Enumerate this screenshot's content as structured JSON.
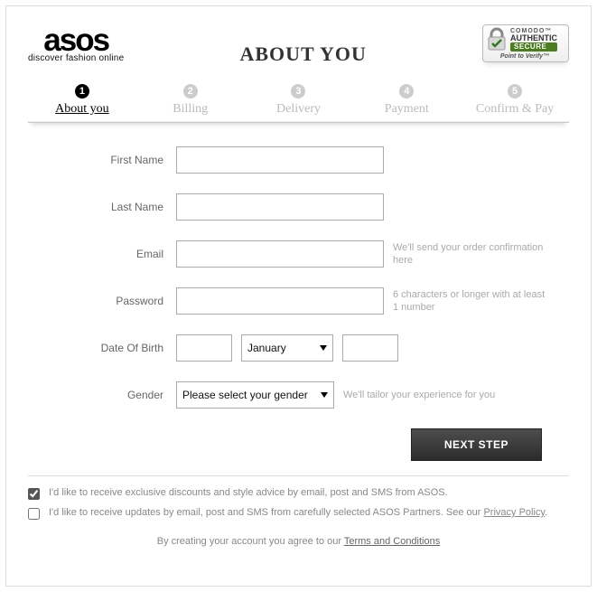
{
  "brand": {
    "name": "asos",
    "tagline": "discover fashion online"
  },
  "title": "ABOUT YOU",
  "secure": {
    "vendor": "COMODO™",
    "main": "AUTHENTIC",
    "green": "SECURE",
    "sub": "Point to Verify™"
  },
  "steps": [
    {
      "n": "1",
      "label": "About you",
      "active": true
    },
    {
      "n": "2",
      "label": "Billing",
      "active": false
    },
    {
      "n": "3",
      "label": "Delivery",
      "active": false
    },
    {
      "n": "4",
      "label": "Payment",
      "active": false
    },
    {
      "n": "5",
      "label": "Confirm & Pay",
      "active": false
    }
  ],
  "form": {
    "firstName": {
      "label": "First Name",
      "value": ""
    },
    "lastName": {
      "label": "Last Name",
      "value": ""
    },
    "email": {
      "label": "Email",
      "value": "",
      "hint": "We'll send your order confirmation here"
    },
    "password": {
      "label": "Password",
      "value": "",
      "hint": "6 characters or longer with at least 1 number"
    },
    "dob": {
      "label": "Date Of Birth",
      "day": "",
      "month": "January",
      "year": ""
    },
    "gender": {
      "label": "Gender",
      "value": "Please select your gender",
      "hint": "We'll tailor your experience for you"
    }
  },
  "submit": "NEXT STEP",
  "consent": {
    "opt1": {
      "checked": true,
      "text": "I'd like to receive exclusive discounts and style advice by email, post and SMS from ASOS."
    },
    "opt2": {
      "checked": false,
      "prefix": "I'd like to receive updates by email, post and SMS from carefully selected ASOS Partners. See our ",
      "link": "Privacy Policy",
      "suffix": "."
    }
  },
  "footer": {
    "prefix": "By creating your account you agree to our ",
    "link": "Terms and Conditions"
  }
}
